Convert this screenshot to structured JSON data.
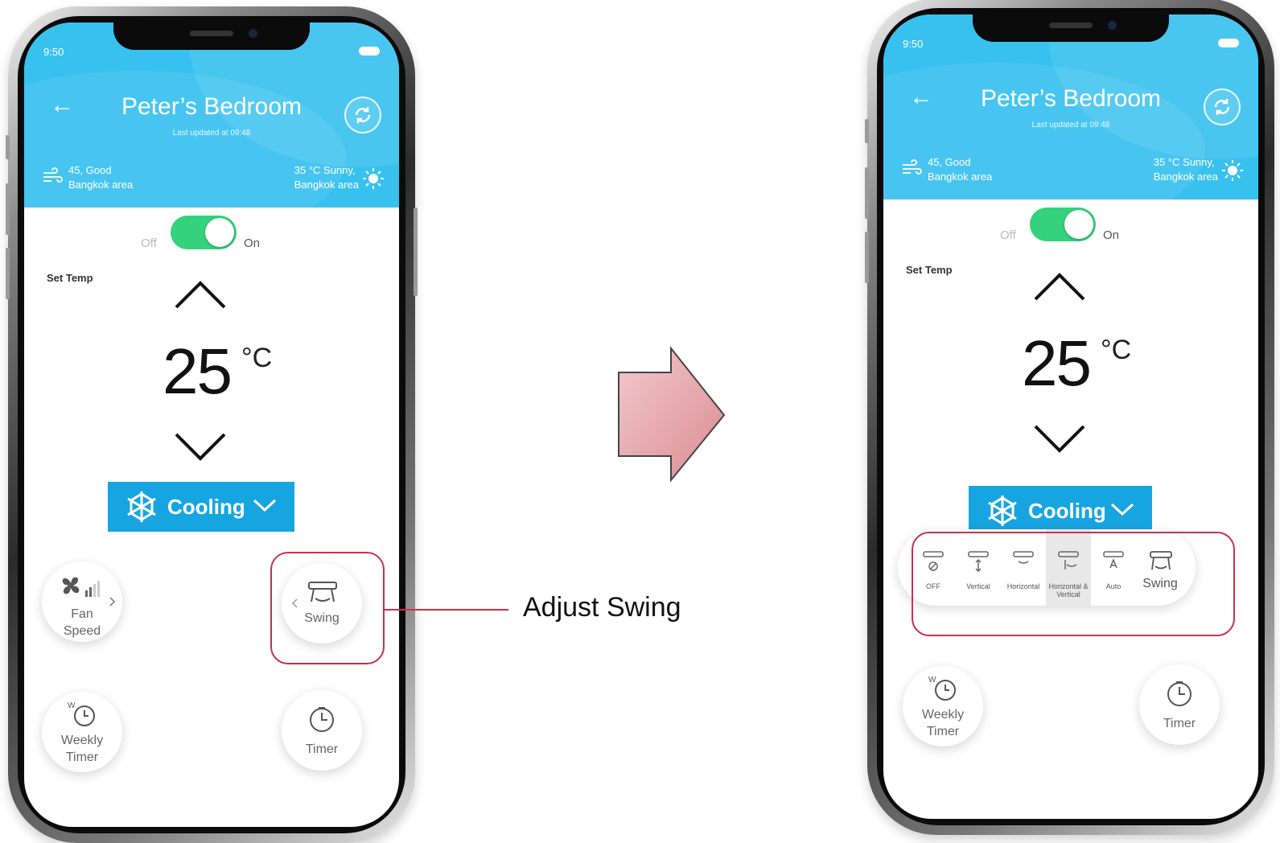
{
  "left_phone": {
    "status_time": "9:50",
    "title": "Peter’s Bedroom",
    "subtitle": "Last updated at 09:48",
    "air_quality": {
      "value": "45, Good",
      "area": "Bangkok area"
    },
    "weather": {
      "value": "35 °C Sunny,",
      "area": "Bangkok area"
    },
    "power": {
      "off_label": "Off",
      "on_label": "On",
      "state": "on"
    },
    "set_temp_label": "Set Temp",
    "temperature": "25",
    "unit": "°C",
    "mode": "Cooling",
    "fan_speed_label": [
      "Fan",
      "Speed"
    ],
    "swing_label": "Swing",
    "weekly_timer_label": [
      "Weekly",
      "Timer"
    ],
    "timer_label": "Timer"
  },
  "right_phone": {
    "status_time": "9:50",
    "title": "Peter’s Bedroom",
    "subtitle": "Last updated at 09:48",
    "air_quality": {
      "value": "45, Good",
      "area": "Bangkok area"
    },
    "weather": {
      "value": "35 °C Sunny,",
      "area": "Bangkok area"
    },
    "power": {
      "off_label": "Off",
      "on_label": "On",
      "state": "on"
    },
    "set_temp_label": "Set Temp",
    "temperature": "25",
    "unit": "°C",
    "mode": "Cooling",
    "swing_options": [
      {
        "label": "OFF",
        "icon": "swing-off-icon"
      },
      {
        "label": "Vertical",
        "icon": "swing-vertical-icon"
      },
      {
        "label": "Horizontal",
        "icon": "swing-horizontal-icon"
      },
      {
        "label": "Horizontal & Vertical",
        "icon": "swing-both-icon",
        "selected": true
      },
      {
        "label": "Auto",
        "icon": "swing-auto-icon"
      },
      {
        "label": "Swing",
        "icon": "swing-icon"
      }
    ],
    "weekly_timer_label": [
      "Weekly",
      "Timer"
    ],
    "timer_label": "Timer"
  },
  "callout": {
    "label": "Adjust Swing"
  },
  "colors": {
    "header": "#38c1ef",
    "mode_button": "#17a5e1",
    "toggle_on": "#34d27c",
    "highlight": "#c4324e",
    "arrow": "#e3a5aa"
  }
}
